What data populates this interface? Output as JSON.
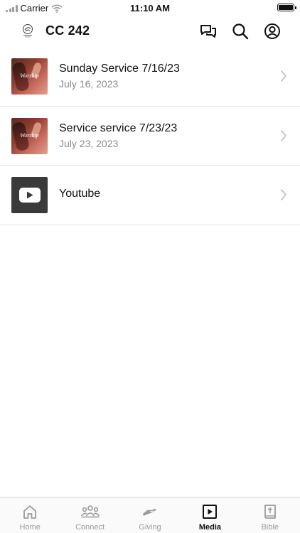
{
  "status_bar": {
    "carrier": "Carrier",
    "time": "11:10 AM"
  },
  "header": {
    "title": "CC 242"
  },
  "media_items": [
    {
      "title": "Sunday Service 7/16/23",
      "date": "July 16, 2023",
      "thumbnail_text": "Worship"
    },
    {
      "title": "Service service 7/23/23",
      "date": "July 23, 2023",
      "thumbnail_text": "Worship"
    },
    {
      "title": "Youtube",
      "thumbnail_icon": "youtube-icon"
    }
  ],
  "tabs": [
    {
      "label": "Home",
      "icon": "home-icon"
    },
    {
      "label": "Connect",
      "icon": "people-icon"
    },
    {
      "label": "Giving",
      "icon": "giving-hand-icon"
    },
    {
      "label": "Media",
      "icon": "play-icon",
      "active": true
    },
    {
      "label": "Bible",
      "icon": "bible-icon"
    }
  ],
  "colors": {
    "text_primary": "#111111",
    "text_secondary": "#8a8a8a",
    "tab_inactive": "#9a9a9a",
    "divider": "#e6e6e6"
  }
}
